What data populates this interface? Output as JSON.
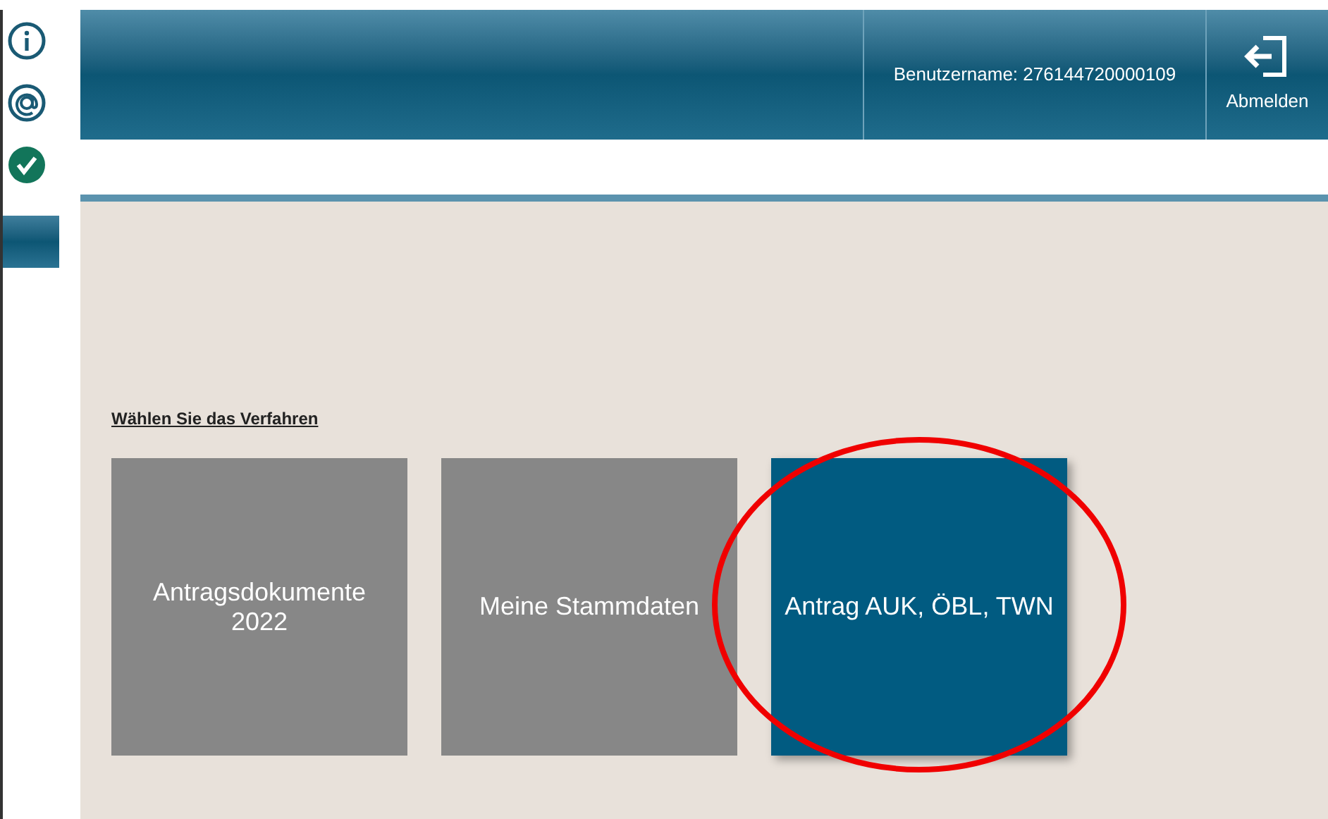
{
  "sidebar": {
    "items": [
      {
        "kind": "info",
        "selected": false
      },
      {
        "kind": "email",
        "selected": false
      },
      {
        "kind": "check",
        "selected": false
      },
      {
        "kind": "blank",
        "selected": true
      }
    ]
  },
  "header": {
    "username": "Benutzername: 276144720000109",
    "logout": "Abmelden"
  },
  "prompt": "Wählen Sie das Verfahren",
  "tiles": [
    {
      "label": "Antragsdokumente 2022",
      "selected": false,
      "circled": false
    },
    {
      "label": "Meine Stammdaten",
      "selected": false,
      "circled": false
    },
    {
      "label": "Antrag AUK, ÖBL, TWN",
      "selected": true,
      "circled": true
    }
  ]
}
